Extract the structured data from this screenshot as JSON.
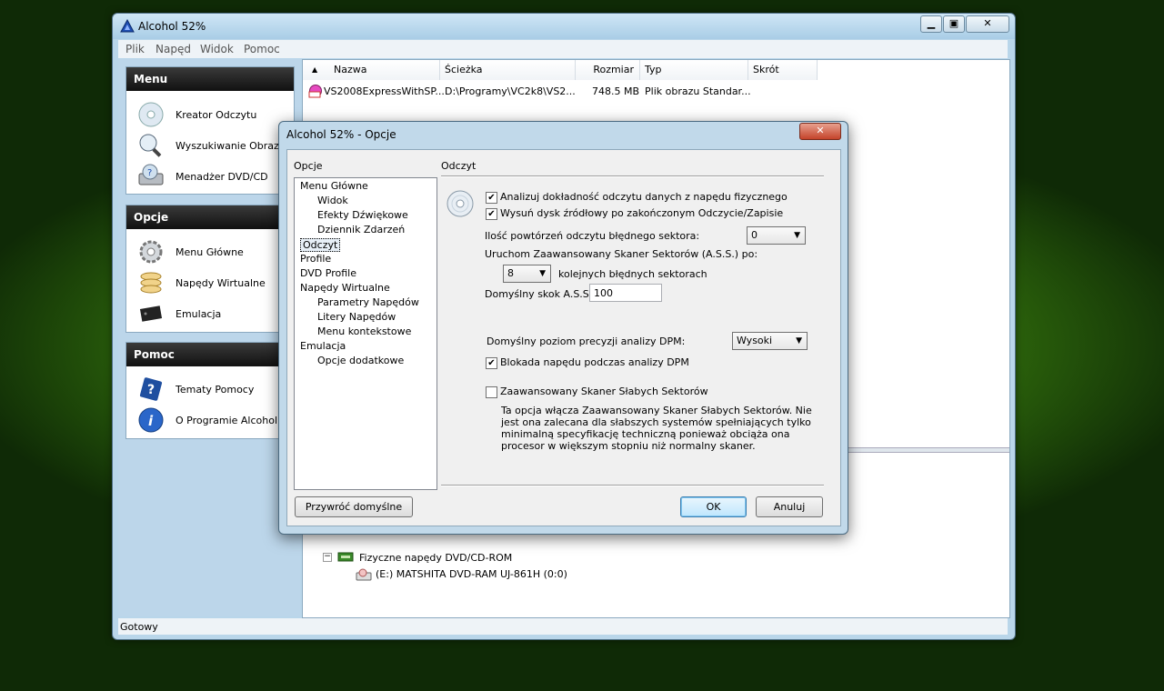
{
  "app": {
    "title": "Alcohol 52%"
  },
  "menubar": [
    "Plik",
    "Napęd",
    "Widok",
    "Pomoc"
  ],
  "sidebar": {
    "sections": [
      {
        "title": "Menu",
        "items": [
          "Kreator Odczytu",
          "Wyszukiwanie Obrazów",
          "Menadżer DVD/CD"
        ]
      },
      {
        "title": "Opcje",
        "items": [
          "Menu Główne",
          "Napędy Wirtualne",
          "Emulacja"
        ]
      },
      {
        "title": "Pomoc",
        "items": [
          "Tematy Pomocy",
          "O Programie Alcohol 5..."
        ]
      }
    ]
  },
  "file_list": {
    "columns": [
      "Nazwa",
      "Ścieżka",
      "Rozmiar",
      "Typ",
      "Skrót"
    ],
    "rows": [
      {
        "name": "VS2008ExpressWithSP...",
        "path": "D:\\Programy\\VC2k8\\VS2...",
        "size": "748.5 MB",
        "type": "Plik obrazu Standar...",
        "shortcut": ""
      }
    ]
  },
  "drives": {
    "group": "Fizyczne napędy DVD/CD-ROM",
    "item": "(E:) MATSHITA DVD-RAM UJ-861H (0:0)"
  },
  "status": "Gotowy",
  "dialog": {
    "title": "Alcohol 52% - Opcje",
    "close": "✕",
    "tree_label": "Opcje",
    "tree": [
      {
        "label": "Menu Główne",
        "level": 0
      },
      {
        "label": "Widok",
        "level": 1
      },
      {
        "label": "Efekty Dźwiękowe",
        "level": 1
      },
      {
        "label": "Dziennik Zdarzeń",
        "level": 1
      },
      {
        "label": "Odczyt",
        "level": 0,
        "selected": true
      },
      {
        "label": "Profile",
        "level": 0
      },
      {
        "label": "DVD Profile",
        "level": 0
      },
      {
        "label": "Napędy Wirtualne",
        "level": 0
      },
      {
        "label": "Parametry Napędów",
        "level": 1
      },
      {
        "label": "Litery Napędów",
        "level": 1
      },
      {
        "label": "Menu kontekstowe",
        "level": 1
      },
      {
        "label": "Emulacja",
        "level": 0
      },
      {
        "label": "Opcje dodatkowe",
        "level": 1
      }
    ],
    "section_title": "Odczyt",
    "analyze_label": "Analizuj dokładność odczytu danych z napędu fizycznego",
    "analyze_checked": true,
    "eject_label": "Wysuń dysk źródłowy po zakończonym Odczycie/Zapisie",
    "eject_checked": true,
    "retries_label": "Ilość powtórzeń odczytu błędnego sektora:",
    "retries_value": "0",
    "ass_label": "Uruchom Zaawansowany Skaner Sektorów (A.S.S.) po:",
    "ass_value": "8",
    "ass_suffix": "kolejnych błędnych sektorach",
    "skip_label": "Domyślny skok A.S.S.:",
    "skip_value": "100",
    "dpm_label": "Domyślny poziom precyzji analizy DPM:",
    "dpm_value": "Wysoki",
    "lock_label": "Blokada napędu podczas analizy DPM",
    "lock_checked": true,
    "weak_label": "Zaawansowany Skaner Słabych Sektorów",
    "weak_checked": false,
    "weak_desc": "Ta opcja włącza Zaawansowany Skaner Słabych Sektorów. Nie jest ona zalecana dla słabszych systemów spełniających tylko minimalną specyfikację techniczną ponieważ obciąża ona procesor w większym stopniu niż normalny skaner.",
    "restore_button": "Przywróć domyślne",
    "ok_button": "OK",
    "cancel_button": "Anuluj"
  }
}
